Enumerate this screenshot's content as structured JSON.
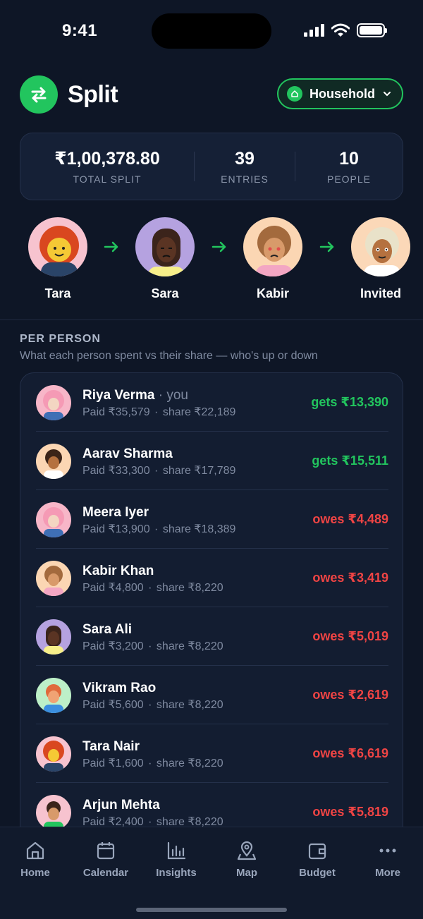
{
  "status": {
    "time": "9:41"
  },
  "header": {
    "title": "Split",
    "group_label": "Household"
  },
  "summary": {
    "total": "₹1,00,378.80",
    "total_label": "TOTAL SPLIT",
    "entries": "39",
    "entries_label": "ENTRIES",
    "people": "10",
    "people_label": "PEOPLE"
  },
  "chain": [
    {
      "name": "Tara"
    },
    {
      "name": "Sara"
    },
    {
      "name": "Kabir"
    },
    {
      "name": "Invited"
    }
  ],
  "per_person": {
    "title": "PER PERSON",
    "subtitle": "What each person spent vs their share — who's up or down",
    "rows": [
      {
        "name": "Riya Verma",
        "you": "· you",
        "paid": "Paid ₹35,579",
        "share": "share ₹22,189",
        "amount": "gets ₹13,390",
        "status": "gets"
      },
      {
        "name": "Aarav Sharma",
        "you": "",
        "paid": "Paid ₹33,300",
        "share": "share ₹17,789",
        "amount": "gets ₹15,511",
        "status": "gets"
      },
      {
        "name": "Meera Iyer",
        "you": "",
        "paid": "Paid ₹13,900",
        "share": "share ₹18,389",
        "amount": "owes ₹4,489",
        "status": "owes"
      },
      {
        "name": "Kabir Khan",
        "you": "",
        "paid": "Paid ₹4,800",
        "share": "share ₹8,220",
        "amount": "owes ₹3,419",
        "status": "owes"
      },
      {
        "name": "Sara Ali",
        "you": "",
        "paid": "Paid ₹3,200",
        "share": "share ₹8,220",
        "amount": "owes ₹5,019",
        "status": "owes"
      },
      {
        "name": "Vikram Rao",
        "you": "",
        "paid": "Paid ₹5,600",
        "share": "share ₹8,220",
        "amount": "owes ₹2,619",
        "status": "owes"
      },
      {
        "name": "Tara Nair",
        "you": "",
        "paid": "Paid ₹1,600",
        "share": "share ₹8,220",
        "amount": "owes ₹6,619",
        "status": "owes"
      },
      {
        "name": "Arjun Mehta",
        "you": "",
        "paid": "Paid ₹2,400",
        "share": "share ₹8,220",
        "amount": "owes ₹5,819",
        "status": "owes"
      }
    ]
  },
  "tabs": [
    {
      "label": "Home",
      "icon": "home-icon"
    },
    {
      "label": "Calendar",
      "icon": "calendar-icon"
    },
    {
      "label": "Insights",
      "icon": "insights-icon"
    },
    {
      "label": "Map",
      "icon": "map-pin-icon"
    },
    {
      "label": "Budget",
      "icon": "wallet-icon"
    },
    {
      "label": "More",
      "icon": "more-icon"
    }
  ],
  "colors": {
    "accent": "#22c55e",
    "negative": "#ef4444",
    "background": "#0e1626"
  }
}
